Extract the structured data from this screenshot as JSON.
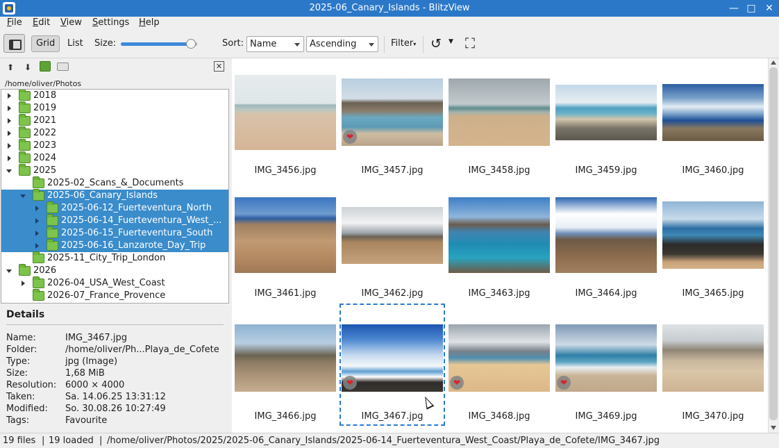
{
  "window": {
    "title": "2025-06_Canary_Islands - BlitzView",
    "minimize": "—",
    "maximize": "□",
    "close": "✕"
  },
  "menu": [
    "File",
    "Edit",
    "View",
    "Settings",
    "Help"
  ],
  "toolbar": {
    "grid_label": "Grid",
    "list_label": "List",
    "size_label": "Size:",
    "size_value": 0.92,
    "sort_label": "Sort:",
    "sort_field": "Name",
    "sort_order": "Ascending",
    "filter_label": "Filter",
    "rotate_glyph": "↺",
    "fullscreen_glyph": "⛶"
  },
  "nav": {
    "path": "/home/oliver/Photos",
    "up_glyph": "⬆",
    "down_glyph": "⬇",
    "close_glyph": "✕"
  },
  "tree": [
    {
      "label": "2018",
      "level": 0,
      "expander": "closed",
      "selected": false
    },
    {
      "label": "2019",
      "level": 0,
      "expander": "closed",
      "selected": false
    },
    {
      "label": "2021",
      "level": 0,
      "expander": "closed",
      "selected": false
    },
    {
      "label": "2022",
      "level": 0,
      "expander": "closed",
      "selected": false
    },
    {
      "label": "2023",
      "level": 0,
      "expander": "closed",
      "selected": false
    },
    {
      "label": "2024",
      "level": 0,
      "expander": "closed",
      "selected": false
    },
    {
      "label": "2025",
      "level": 0,
      "expander": "open",
      "selected": false
    },
    {
      "label": "2025-02_Scans_&_Documents",
      "level": 1,
      "expander": "none",
      "selected": false
    },
    {
      "label": "2025-06_Canary_Islands",
      "level": 1,
      "expander": "open",
      "selected": true
    },
    {
      "label": "2025-06-12_Fuerteventura_North",
      "level": 2,
      "expander": "closed",
      "selected": true
    },
    {
      "label": "2025-06-14_Fuerteventura_West_...",
      "level": 2,
      "expander": "closed",
      "selected": true
    },
    {
      "label": "2025-06-15_Fuerteventura_South",
      "level": 2,
      "expander": "closed",
      "selected": true
    },
    {
      "label": "2025-06-16_Lanzarote_Day_Trip",
      "level": 2,
      "expander": "closed",
      "selected": true
    },
    {
      "label": "2025-11_City_Trip_London",
      "level": 1,
      "expander": "none",
      "selected": false
    },
    {
      "label": "2026",
      "level": 0,
      "expander": "open",
      "selected": false
    },
    {
      "label": "2026-04_USA_West_Coast",
      "level": 1,
      "expander": "closed",
      "selected": false
    },
    {
      "label": "2026-07_France_Provence",
      "level": 1,
      "expander": "none",
      "selected": false
    }
  ],
  "details": {
    "heading": "Details",
    "rows": [
      {
        "key": "Name:",
        "value": "IMG_3467.jpg"
      },
      {
        "key": "Folder:",
        "value": "/home/oliver/Ph...Playa_de_Cofete"
      },
      {
        "key": "Type:",
        "value": "jpg (Image)"
      },
      {
        "key": "Size:",
        "value": "1,68 MiB"
      },
      {
        "key": "Resolution:",
        "value": "6000 × 4000"
      },
      {
        "key": "Taken:",
        "value": "Sa. 14.06.25 13:31:12"
      },
      {
        "key": "Modified:",
        "value": "So. 30.08.26 10:27:49"
      },
      {
        "key": "Tags:",
        "value": "Favourite"
      }
    ]
  },
  "images": [
    {
      "name": "IMG_3456.jpg",
      "favourite": false,
      "scene": "beach-haze"
    },
    {
      "name": "IMG_3457.jpg",
      "favourite": true,
      "scene": "cliff-sea"
    },
    {
      "name": "IMG_3458.jpg",
      "favourite": false,
      "scene": "beach-dunes"
    },
    {
      "name": "IMG_3459.jpg",
      "favourite": false,
      "scene": "rocky-shore"
    },
    {
      "name": "IMG_3460.jpg",
      "favourite": false,
      "scene": "coast-clouds"
    },
    {
      "name": "IMG_3461.jpg",
      "favourite": false,
      "scene": "desert-hills"
    },
    {
      "name": "IMG_3462.jpg",
      "favourite": false,
      "scene": "hills-clouds"
    },
    {
      "name": "IMG_3463.jpg",
      "favourite": false,
      "scene": "bay-blue"
    },
    {
      "name": "IMG_3464.jpg",
      "favourite": false,
      "scene": "valley-clouds"
    },
    {
      "name": "IMG_3465.jpg",
      "favourite": false,
      "scene": "lava-shore"
    },
    {
      "name": "IMG_3466.jpg",
      "favourite": false,
      "scene": "plain-mountain"
    },
    {
      "name": "IMG_3467.jpg",
      "favourite": true,
      "scene": "wave-sky"
    },
    {
      "name": "IMG_3468.jpg",
      "favourite": true,
      "scene": "beach-walker"
    },
    {
      "name": "IMG_3469.jpg",
      "favourite": true,
      "scene": "beach-waves"
    },
    {
      "name": "IMG_3470.jpg",
      "favourite": false,
      "scene": "beach-people"
    }
  ],
  "status": {
    "files": "19 files",
    "loaded": "19 loaded",
    "path": "/home/oliver/Photos/2025/2025-06_Canary_Islands/2025-06-14_Fuerteventura_West_Coast/Playa_de_Cofete/IMG_3467.jpg"
  }
}
